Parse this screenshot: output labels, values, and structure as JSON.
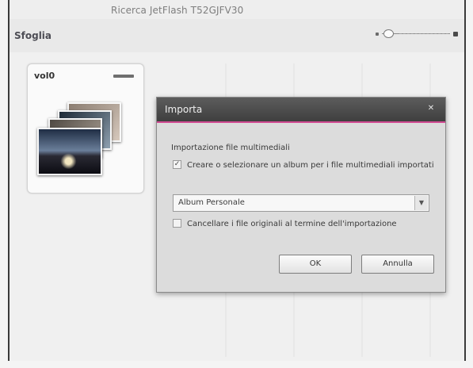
{
  "window": {
    "title": "Ricerca JetFlash T52GJFV30"
  },
  "header": {
    "title": "Sfoglia"
  },
  "volume": {
    "label": "vol0"
  },
  "dialog": {
    "title": "Importa",
    "close_glyph": "✕",
    "section_label": "Importazione file multimediali",
    "create_album": {
      "checked": true,
      "label": "Creare o selezionare un album per i file multimediali importati"
    },
    "album_select": {
      "value": "Album Personale",
      "arrow_glyph": "▼"
    },
    "delete_originals": {
      "checked": false,
      "label": "Cancellare i file originali al termine dell'importazione"
    },
    "ok_label": "OK",
    "cancel_label": "Annulla"
  },
  "colors": {
    "dialog_titlebar": "#4a4a4a",
    "dialog_accent": "#d14a92",
    "background": "#eeeeee"
  }
}
